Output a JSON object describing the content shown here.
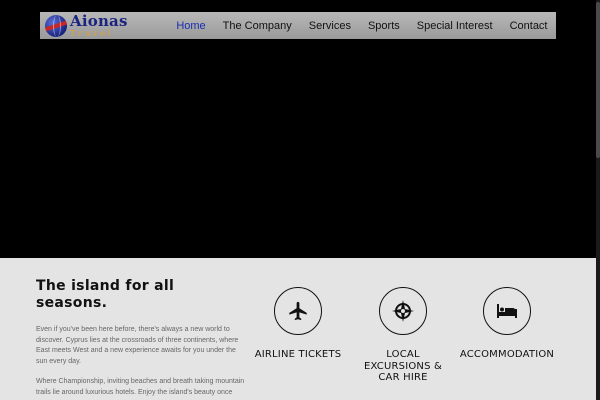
{
  "brand": {
    "name": "Aionas",
    "sub": "Travel"
  },
  "nav": {
    "items": [
      {
        "label": "Home",
        "active": true
      },
      {
        "label": "The Company"
      },
      {
        "label": "Services"
      },
      {
        "label": "Sports"
      },
      {
        "label": "Special Interest"
      },
      {
        "label": "Contact"
      }
    ]
  },
  "intro": {
    "heading": "The island for all seasons.",
    "paragraph_1": "Even if you've been here before, there's always a new world to discover. Cyprus lies at the crossroads of three continents, where East meets West and a new experience awaits for you under the sun every day.",
    "paragraph_2": "Where Championship, inviting beaches and breath taking mountain trails lie around luxurious hotels. Enjoy the island's beauty once more."
  },
  "services": [
    {
      "label": "Airline Tickets",
      "icon": "airplane-icon"
    },
    {
      "label": "Local Excursions & Car Hire",
      "icon": "compass-icon"
    },
    {
      "label": "Accommodation",
      "icon": "bed-icon"
    }
  ],
  "colors": {
    "nav_active": "#1a2bb0",
    "brand_blue": "#1a237e",
    "brand_orange": "#e0a030",
    "content_bg": "#e4e4e4"
  }
}
